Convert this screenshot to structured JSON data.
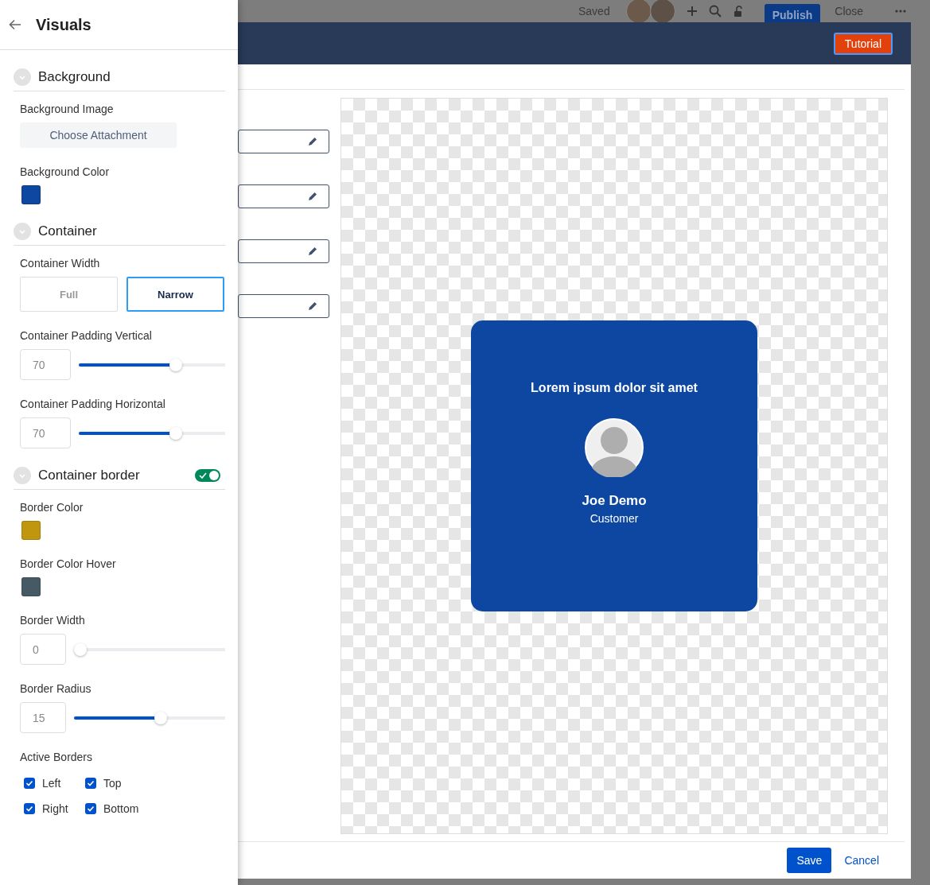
{
  "toolbar": {
    "status": "Saved",
    "publish": "Publish",
    "close": "Close"
  },
  "modal": {
    "tutorial": "Tutorial",
    "fields": [
      {
        "kind": "editable"
      },
      {
        "kind": "editable"
      },
      {
        "kind": "editable"
      },
      {
        "kind": "editable"
      }
    ],
    "preview": {
      "card": {
        "title": "Lorem ipsum dolor sit amet",
        "name": "Joe Demo",
        "role": "Customer"
      }
    },
    "footer": {
      "save": "Save",
      "cancel": "Cancel"
    }
  },
  "panel": {
    "title": "Visuals",
    "sections": [
      {
        "title": "Background",
        "controls": [
          {
            "kind": "attachment",
            "label": "Background Image",
            "button": "Choose Attachment"
          },
          {
            "kind": "color",
            "label": "Background Color",
            "color": "#0d47a1"
          }
        ]
      },
      {
        "title": "Container",
        "controls": [
          {
            "kind": "segmented",
            "label": "Container Width",
            "options": [
              {
                "label": "Full",
                "selected": false
              },
              {
                "label": "Narrow",
                "selected": true
              }
            ]
          },
          {
            "kind": "slider",
            "label": "Container Padding Vertical",
            "value": "70",
            "level": 0.68
          },
          {
            "kind": "slider",
            "label": "Container Padding Horizontal",
            "value": "70",
            "level": 0.68
          }
        ]
      },
      {
        "title": "Container border",
        "toggle_on": true,
        "controls": [
          {
            "kind": "color",
            "label": "Border Color",
            "color": "#c0960f"
          },
          {
            "kind": "color",
            "label": "Border Color Hover",
            "color": "#455a64"
          },
          {
            "kind": "slider",
            "label": "Border Width",
            "value": "0",
            "level": 0
          },
          {
            "kind": "slider",
            "label": "Border Radius",
            "value": "15",
            "level": 0.58
          },
          {
            "kind": "checkboxes",
            "label": "Active Borders",
            "options": [
              {
                "label": "Left",
                "checked": true
              },
              {
                "label": "Top",
                "checked": true
              },
              {
                "label": "Right",
                "checked": true
              },
              {
                "label": "Bottom",
                "checked": true
              }
            ]
          }
        ]
      }
    ]
  }
}
